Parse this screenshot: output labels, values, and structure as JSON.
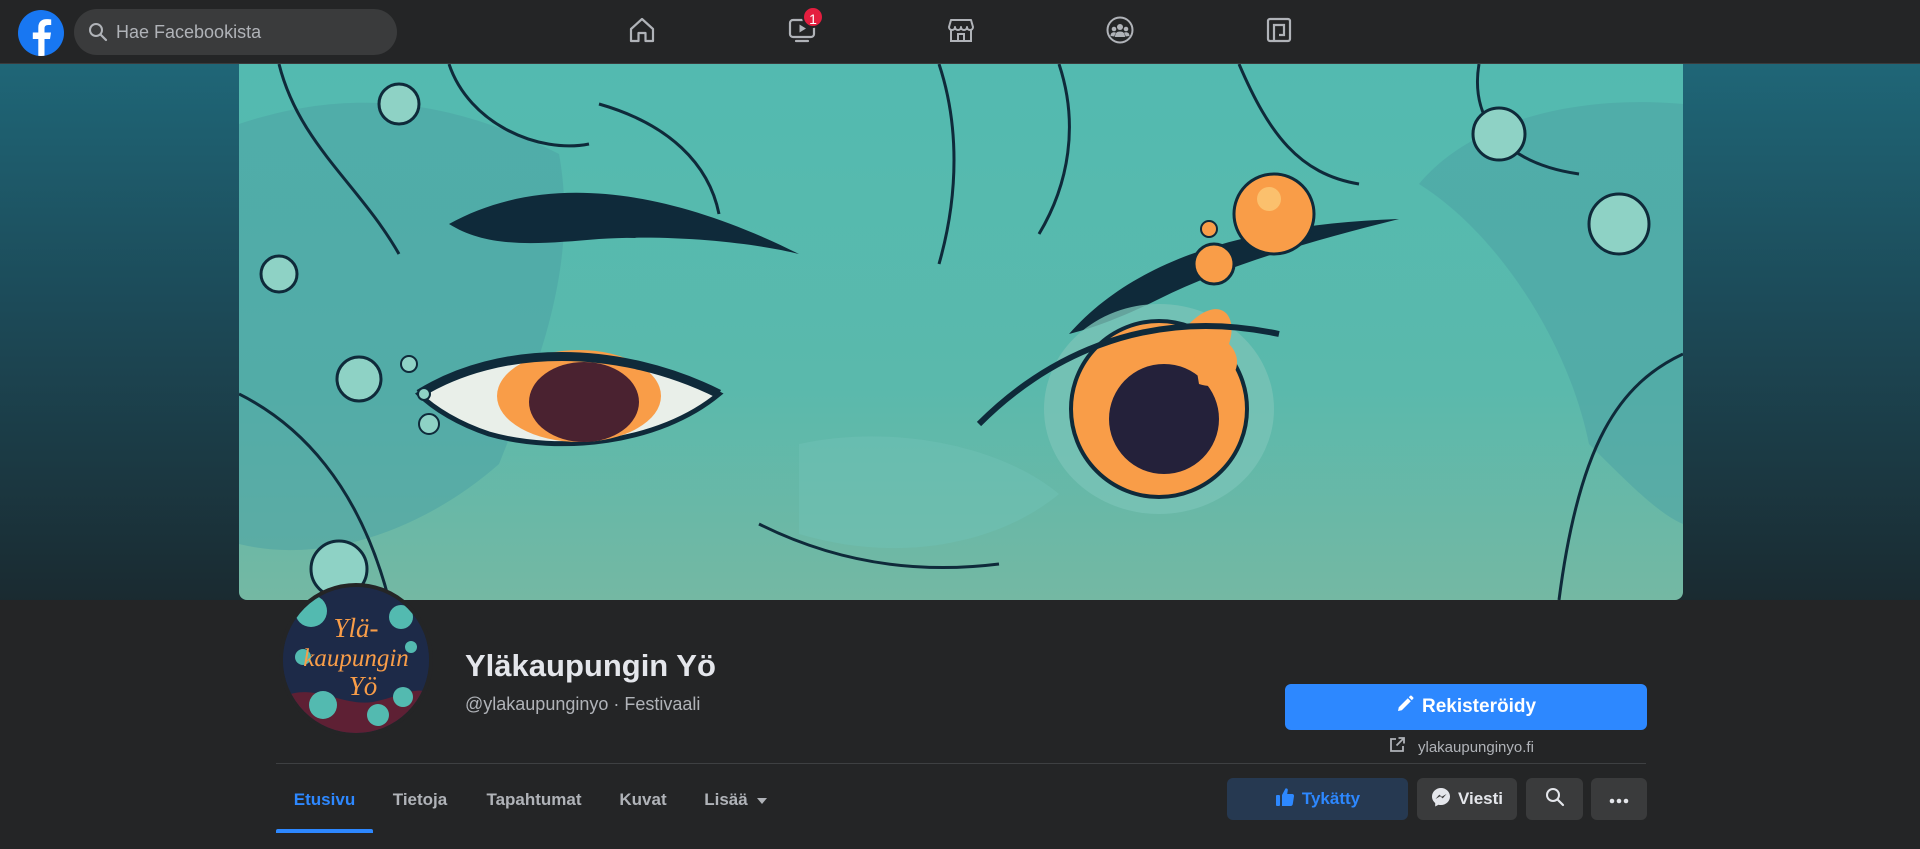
{
  "topnav": {
    "search_placeholder": "Hae Facebookista",
    "watch_badge": "1",
    "icons": [
      "home-icon",
      "watch-icon",
      "marketplace-icon",
      "groups-icon",
      "gaming-icon"
    ]
  },
  "colors": {
    "accent": "#2d88ff",
    "background": "#18191a",
    "surface": "#242526",
    "badge": "#e41e3f",
    "cover_teal": "#53bab0",
    "cover_orange": "#f99d48"
  },
  "page": {
    "avatar_text": [
      "Ylä-",
      "kaupungin",
      "Yö"
    ],
    "title": "Yläkaupungin Yö",
    "meta": "@ylakaupunginyo · Festivaali",
    "primary_button": "Rekisteröidy",
    "website": "ylakaupunginyo.fi"
  },
  "tabs": [
    {
      "label": "Etusivu",
      "active": true
    },
    {
      "label": "Tietoja",
      "active": false
    },
    {
      "label": "Tapahtumat",
      "active": false
    },
    {
      "label": "Kuvat",
      "active": false
    },
    {
      "label": "Lisää",
      "active": false
    }
  ],
  "actions": {
    "liked": "Tykätty",
    "message": "Viesti"
  }
}
